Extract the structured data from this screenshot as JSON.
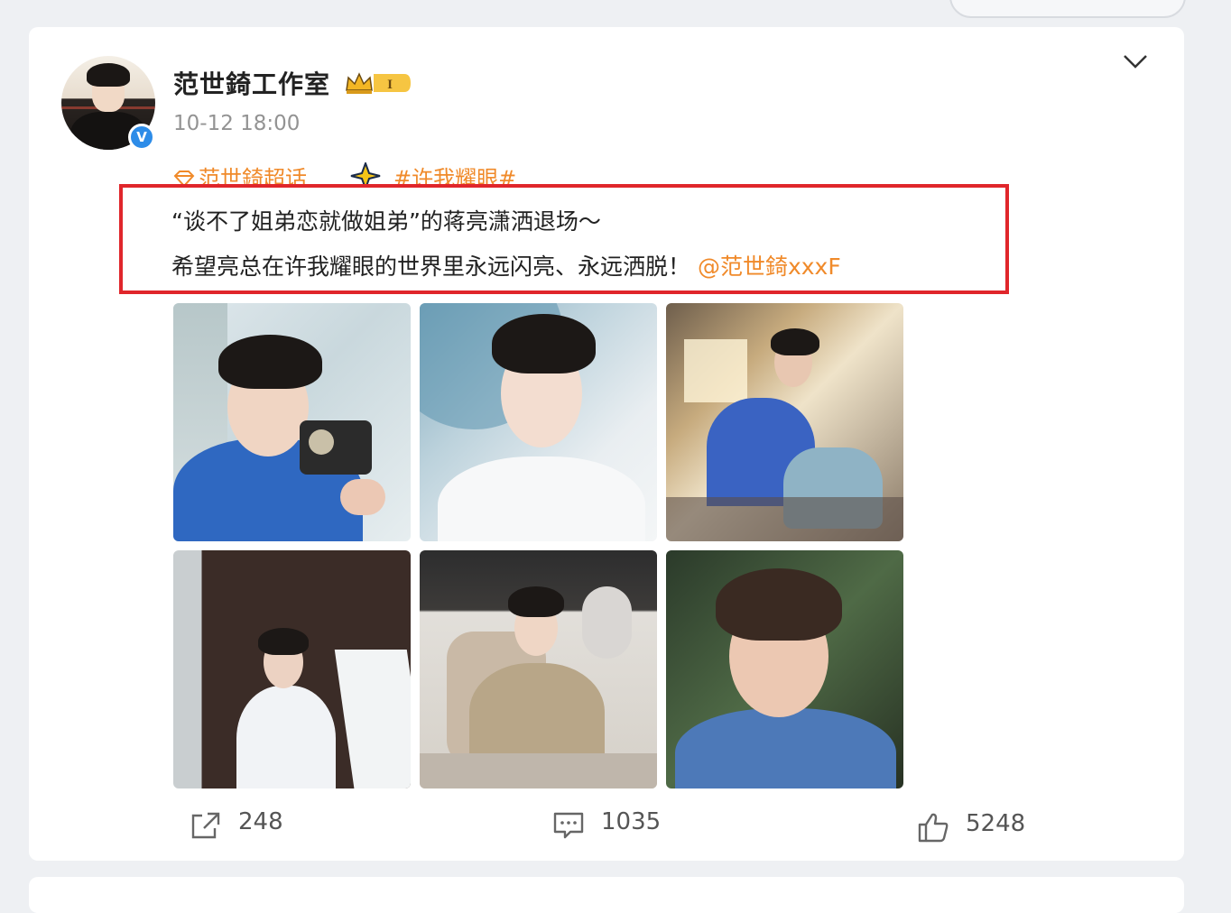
{
  "post": {
    "author": "范世錡工作室",
    "badge_level": "I",
    "timestamp": "10-12 18:00",
    "super_topic": "范世錡超话",
    "topic_tag": "#许我耀眼#",
    "text_line1": "“谈不了姐弟恋就做姐弟”的蒋亮潇洒退场～",
    "text_line2": "希望亮总在许我耀眼的世界里永远闪亮、永远洒脱！",
    "mention": "@范世錡xxxF",
    "verified_mark": "V"
  },
  "stats": {
    "reposts": "248",
    "comments": "1035",
    "likes": "5248"
  },
  "icons": {
    "repost": "repost-icon",
    "comment": "comment-icon",
    "like": "like-icon",
    "more": "chevron-down-icon"
  },
  "colors": {
    "accent": "#f08a2a",
    "highlight_border": "#e0262b",
    "verified": "#2d8ce8"
  }
}
